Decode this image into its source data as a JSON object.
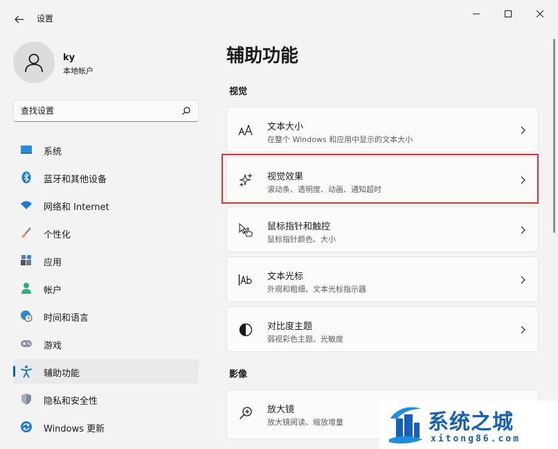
{
  "window": {
    "title": "设置"
  },
  "user": {
    "name": "ky",
    "account_type": "本地帐户"
  },
  "search": {
    "placeholder": "查找设置"
  },
  "sidebar": {
    "items": [
      {
        "label": "系统",
        "icon": "monitor-icon"
      },
      {
        "label": "蓝牙和其他设备",
        "icon": "bluetooth-icon"
      },
      {
        "label": "网络和 Internet",
        "icon": "wifi-icon"
      },
      {
        "label": "个性化",
        "icon": "brush-icon"
      },
      {
        "label": "应用",
        "icon": "apps-icon"
      },
      {
        "label": "帐户",
        "icon": "account-icon"
      },
      {
        "label": "时间和语言",
        "icon": "globe-clock-icon"
      },
      {
        "label": "游戏",
        "icon": "gamepad-icon"
      },
      {
        "label": "辅助功能",
        "icon": "accessibility-icon",
        "active": true
      },
      {
        "label": "隐私和安全性",
        "icon": "shield-icon"
      },
      {
        "label": "Windows 更新",
        "icon": "update-icon"
      }
    ]
  },
  "main": {
    "title": "辅助功能",
    "sections": [
      {
        "title": "视觉",
        "cards": [
          {
            "title": "文本大小",
            "desc": "在整个 Windows 和应用中显示的文本大小",
            "icon": "text-size-icon"
          },
          {
            "title": "视觉效果",
            "desc": "滚动条、透明度、动画、通知超时",
            "icon": "sparkle-icon",
            "highlighted": true
          },
          {
            "title": "鼠标指针和触控",
            "desc": "鼠标指针颜色、大小",
            "icon": "pointer-touch-icon"
          },
          {
            "title": "文本光标",
            "desc": "外观和粗细、文本光标指示器",
            "icon": "text-cursor-icon"
          },
          {
            "title": "对比度主题",
            "desc": "弱视彩色主题、光敏度",
            "icon": "contrast-icon"
          }
        ]
      },
      {
        "title": "影像",
        "cards": [
          {
            "title": "放大镜",
            "desc": "放大镜阅读、缩放增量",
            "icon": "magnifier-icon"
          }
        ]
      }
    ]
  },
  "watermark": {
    "name_cn": "系统之城",
    "domain": "xitong86.com"
  },
  "colors": {
    "accent": "#0067c0",
    "highlight_border": "#e53030",
    "watermark": "#1560b8"
  }
}
